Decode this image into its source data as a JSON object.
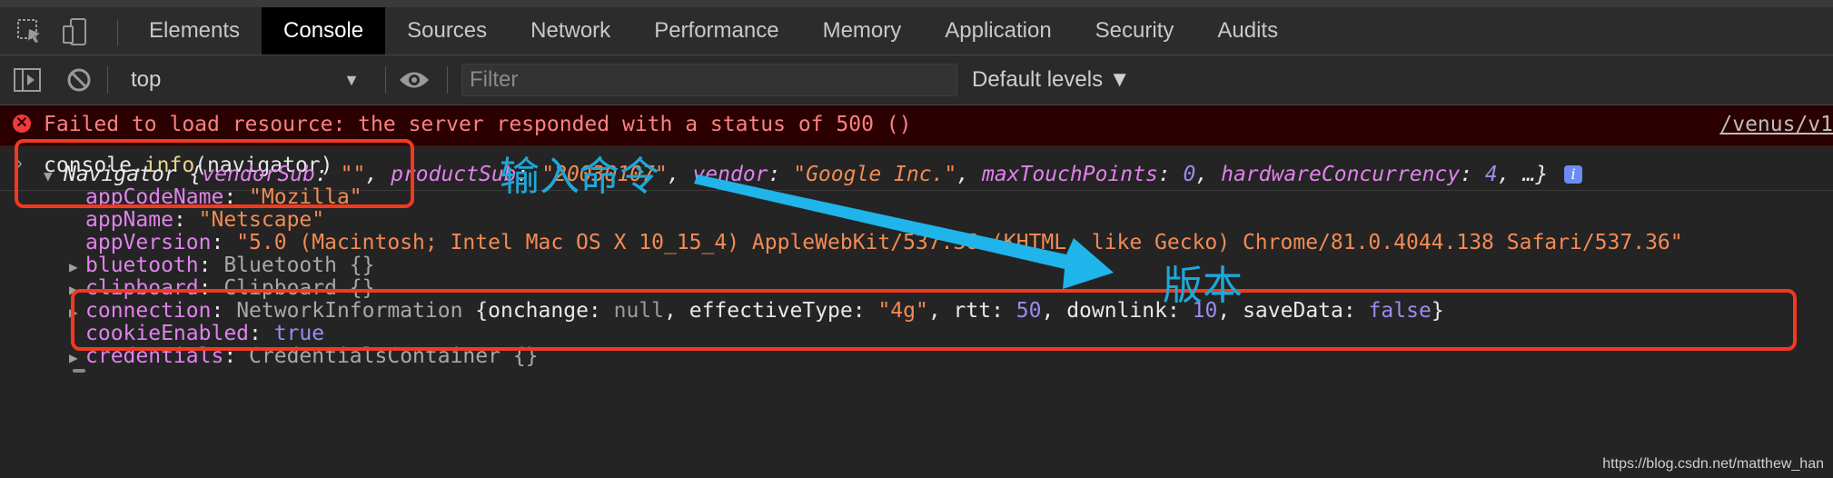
{
  "tabs": [
    "Elements",
    "Console",
    "Sources",
    "Network",
    "Performance",
    "Memory",
    "Application",
    "Security",
    "Audits"
  ],
  "active_tab": "Console",
  "toolbar": {
    "context": "top",
    "filter_placeholder": "Filter",
    "levels": "Default levels ▼"
  },
  "error": {
    "message": "Failed to load resource: the server responded with a status of 500 ()",
    "source": "/venus/v1"
  },
  "command": {
    "object": "console",
    "dot": ".",
    "method": "info",
    "args": "(navigator)"
  },
  "annotations": {
    "input_label": "输入命令",
    "version_label": "版本"
  },
  "navigator": {
    "name": "Navigator",
    "summary": [
      {
        "key": "vendorSub",
        "value": "\"\""
      },
      {
        "key": "productSub",
        "value": "\"20030107\""
      },
      {
        "key": "vendor",
        "value": "\"Google Inc.\""
      },
      {
        "key": "maxTouchPoints",
        "value": "0"
      },
      {
        "key": "hardwareConcurrency",
        "value": "4"
      }
    ],
    "ellipsis": "…}",
    "props": {
      "appCodeName": {
        "key": "appCodeName",
        "value": "\"Mozilla\""
      },
      "appName": {
        "key": "appName",
        "value": "\"Netscape\""
      },
      "appVersion": {
        "key": "appVersion",
        "value": "\"5.0 (Macintosh; Intel Mac OS X 10_15_4) AppleWebKit/537.36 (KHTML, like Gecko) Chrome/81.0.4044.138 Safari/537.36\""
      },
      "bluetooth": {
        "key": "bluetooth",
        "value": "Bluetooth {}"
      },
      "clipboard": {
        "key": "clipboard",
        "value": "Clipboard {}"
      },
      "connection": {
        "key": "connection",
        "type": "NetworkInformation",
        "fields": [
          {
            "key": "onchange",
            "value": "null"
          },
          {
            "key": "effectiveType",
            "value": "\"4g\""
          },
          {
            "key": "rtt",
            "value": "50"
          },
          {
            "key": "downlink",
            "value": "10"
          },
          {
            "key": "saveData",
            "value": "false"
          }
        ]
      },
      "cookieEnabled": {
        "key": "cookieEnabled",
        "value": "true"
      },
      "credentials": {
        "key": "credentials",
        "value": "CredentialsContainer {}"
      }
    }
  },
  "watermark": "https://blog.csdn.net/matthew_han"
}
